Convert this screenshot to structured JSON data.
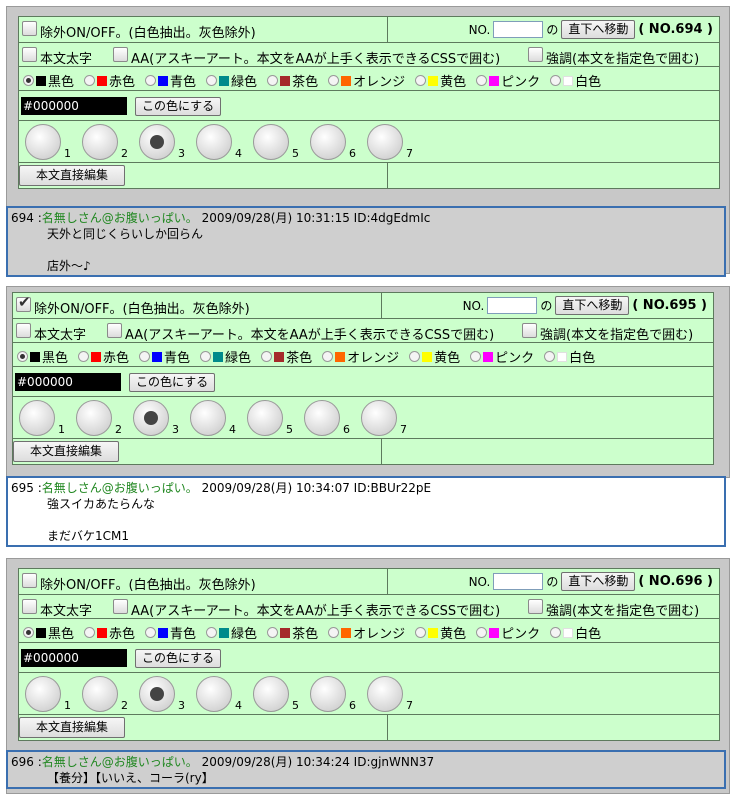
{
  "exclude_label": "除外ON/OFF。(白色抽出。灰色除外)",
  "no_label": "NO.",
  "no_suffix": "の",
  "jump_button": "直下へ移動",
  "bold_label": "本文太字",
  "aa_label": "AA(アスキーアート。本文をAAが上手く表示できるCSSで囲む)",
  "emph_label": "強調(本文を指定色で囲む)",
  "colors": [
    {
      "label": "黒色",
      "hex": "#000000"
    },
    {
      "label": "赤色",
      "hex": "#ff0000"
    },
    {
      "label": "青色",
      "hex": "#0000ff"
    },
    {
      "label": "緑色",
      "hex": "#008b8b"
    },
    {
      "label": "茶色",
      "hex": "#a52a2a"
    },
    {
      "label": "オレンジ",
      "hex": "#ff6600"
    },
    {
      "label": "黄色",
      "hex": "#ffff00"
    },
    {
      "label": "ピンク",
      "hex": "#ff00ff"
    },
    {
      "label": "白色",
      "hex": "#ffffff"
    }
  ],
  "selected_color_index": 0,
  "color_value": "#000000",
  "apply_color_button": "この色にする",
  "size_options": [
    "1",
    "2",
    "3",
    "4",
    "5",
    "6",
    "7"
  ],
  "selected_size_index": 2,
  "edit_button": "本文直接編集",
  "posts": [
    {
      "number_label": "( NO.694 )",
      "exclude_checked": false,
      "post_background": "#cfcfcf",
      "header": "694 :",
      "name": "名無しさん@お腹いっぱい。",
      "date": "2009/09/28(月) 10:31:15 ID:4dgEdmIc",
      "lines": [
        "天外と同じくらいしか回らん",
        "",
        "店外～♪"
      ]
    },
    {
      "number_label": "( NO.695 )",
      "exclude_checked": true,
      "post_background": "#ffffff",
      "header": "695 :",
      "name": "名無しさん@お腹いっぱい。",
      "date": "2009/09/28(月) 10:34:07 ID:BBUr22pE",
      "lines": [
        "強スイカあたらんな",
        "",
        "まだバケ1CM1"
      ]
    },
    {
      "number_label": "( NO.696 )",
      "exclude_checked": false,
      "post_background": "#cfcfcf",
      "header": "696 :",
      "name": "名無しさん@お腹いっぱい。",
      "date": "2009/09/28(月) 10:34:24 ID:gjnWNN37",
      "lines": [
        "【養分】【いいえ、コーラ(ry】"
      ]
    }
  ]
}
